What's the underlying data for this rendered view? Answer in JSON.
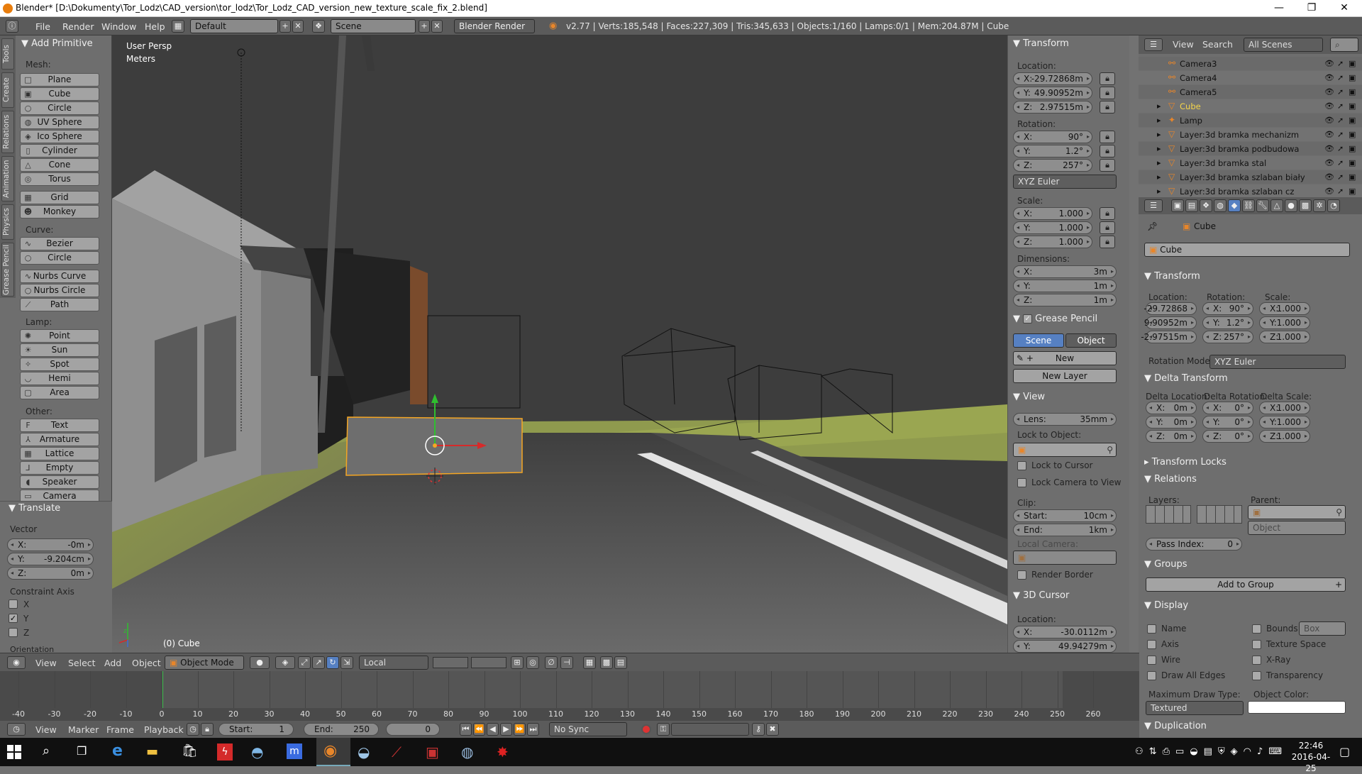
{
  "titlebar": {
    "title": "Blender* [D:\\Dokumenty\\Tor_Lodz\\CAD_version\\tor_lodz\\Tor_Lodz_CAD_version_new_texture_scale_fix_2.blend]",
    "minimize": "—",
    "maximize": "❐",
    "close": "✕"
  },
  "infobar": {
    "menus": [
      "File",
      "Render",
      "Window",
      "Help"
    ],
    "layout": "Default",
    "scene": "Scene",
    "engine": "Blender Render",
    "stats": "v2.77 | Verts:185,548 | Faces:227,309 | Tris:345,633 | Objects:1/160 | Lamps:0/1 | Mem:204.87M | Cube"
  },
  "tools": {
    "vtabs": [
      "Tools",
      "Create",
      "Relations",
      "Animation",
      "Physics",
      "Grease Pencil"
    ],
    "header": "Add Primitive",
    "mesh_label": "Mesh:",
    "mesh": [
      "Plane",
      "Cube",
      "Circle",
      "UV Sphere",
      "Ico Sphere",
      "Cylinder",
      "Cone",
      "Torus"
    ],
    "mesh2": [
      "Grid",
      "Monkey"
    ],
    "curve_label": "Curve:",
    "curve": [
      "Bezier",
      "Circle"
    ],
    "curve2": [
      "Nurbs Curve",
      "Nurbs Circle",
      "Path"
    ],
    "lamp_label": "Lamp:",
    "lamp": [
      "Point",
      "Sun",
      "Spot",
      "Hemi",
      "Area"
    ],
    "other_label": "Other:",
    "other": [
      "Text",
      "Armature",
      "Lattice",
      "Empty",
      "Speaker",
      "Camera"
    ]
  },
  "operator": {
    "header": "Translate",
    "vector_label": "Vector",
    "x_label": "X:",
    "x": "-0m",
    "y_label": "Y:",
    "y": "-9.204cm",
    "z_label": "Z:",
    "z": "0m",
    "constraint_label": "Constraint Axis",
    "cx": "X",
    "cy": "Y",
    "cz": "Z",
    "orientation": "Orientation"
  },
  "viewport": {
    "view_name": "User Persp",
    "units": "Meters",
    "object_label": "(0) Cube"
  },
  "npanel": {
    "transform_header": "Transform",
    "location_label": "Location:",
    "loc": [
      [
        "X:",
        "-29.72868m"
      ],
      [
        "Y:",
        "49.90952m"
      ],
      [
        "Z:",
        "2.97515m"
      ]
    ],
    "rotation_label": "Rotation:",
    "rot": [
      [
        "X:",
        "90°"
      ],
      [
        "Y:",
        "1.2°"
      ],
      [
        "Z:",
        "257°"
      ]
    ],
    "rot_mode": "XYZ Euler",
    "scale_label": "Scale:",
    "scale": [
      [
        "X:",
        "1.000"
      ],
      [
        "Y:",
        "1.000"
      ],
      [
        "Z:",
        "1.000"
      ]
    ],
    "dimensions_label": "Dimensions:",
    "dims": [
      [
        "X:",
        "3m"
      ],
      [
        "Y:",
        "1m"
      ],
      [
        "Z:",
        "1m"
      ]
    ],
    "grease_header": "Grease Pencil",
    "gp_scene": "Scene",
    "gp_object": "Object",
    "gp_new": "New",
    "gp_new_layer": "New Layer",
    "view_header": "View",
    "lens_label": "Lens:",
    "lens": "35mm",
    "lock_object": "Lock to Object:",
    "lock_cursor": "Lock to Cursor",
    "lock_camera": "Lock Camera to View",
    "clip_label": "Clip:",
    "clip_start_label": "Start:",
    "clip_start": "10cm",
    "clip_end_label": "End:",
    "clip_end": "1km",
    "local_camera": "Local Camera:",
    "render_border": "Render Border",
    "cursor_header": "3D Cursor",
    "cursor_loc_label": "Location:",
    "cursor": [
      [
        "X:",
        "-30.0112m"
      ],
      [
        "Y:",
        "49.94279m"
      ]
    ]
  },
  "outliner": {
    "view": "View",
    "search": "Search",
    "scenes": "All Scenes",
    "items": [
      "Camera3",
      "Camera4",
      "Camera5",
      "Cube",
      "Lamp",
      "Layer:3d bramka mechanizm",
      "Layer:3d bramka podbudowa",
      "Layer:3d bramka stal",
      "Layer:3d bramka szlaban biały",
      "Layer:3d bramka szlaban cz"
    ]
  },
  "properties": {
    "breadcrumb": "Cube",
    "name": "Cube",
    "transform_header": "Transform",
    "location_label": "Location:",
    "rotation_label": "Rotation:",
    "scale_label": "Scale:",
    "loc": [
      "-29.72868",
      "9.90952m",
      "-2.97515m"
    ],
    "rot": [
      [
        "X:",
        "90°"
      ],
      [
        "Y:",
        "1.2°"
      ],
      [
        "Z:",
        "257°"
      ]
    ],
    "scale": [
      [
        "X:",
        "1.000"
      ],
      [
        "Y:",
        "1.000"
      ],
      [
        "Z:",
        "1.000"
      ]
    ],
    "rotation_mode_label": "Rotation Mode:",
    "rotation_mode": "XYZ Euler",
    "delta_header": "Delta Transform",
    "delta_loc_label": "Delta Location:",
    "delta_rot_label": "Delta Rotation:",
    "delta_scale_label": "Delta Scale:",
    "delta_loc": [
      [
        "X:",
        "0m"
      ],
      [
        "Y:",
        "0m"
      ],
      [
        "Z:",
        "0m"
      ]
    ],
    "delta_rot": [
      [
        "X:",
        "0°"
      ],
      [
        "Y:",
        "0°"
      ],
      [
        "Z:",
        "0°"
      ]
    ],
    "delta_scale": [
      [
        "X:",
        "1.000"
      ],
      [
        "Y:",
        "1.000"
      ],
      [
        "Z:",
        "1.000"
      ]
    ],
    "locks_header": "Transform Locks",
    "relations_header": "Relations",
    "layers_label": "Layers:",
    "parent_label": "Parent:",
    "parent_type": "Object",
    "pass_index_label": "Pass Index:",
    "pass_index": "0",
    "groups_header": "Groups",
    "add_group": "Add to Group",
    "display_header": "Display",
    "d_name": "Name",
    "d_axis": "Axis",
    "d_wire": "Wire",
    "d_alledges": "Draw All Edges",
    "d_bounds": "Bounds",
    "d_bounds_type": "Box",
    "d_texspace": "Texture Space",
    "d_xray": "X-Ray",
    "d_transp": "Transparency",
    "max_draw_label": "Maximum Draw Type:",
    "max_draw": "Textured",
    "obj_color_label": "Object Color:",
    "duplication_header": "Duplication"
  },
  "vp3dheader": {
    "menus": [
      "View",
      "Select",
      "Add",
      "Object"
    ],
    "mode": "Object Mode",
    "orientation": "Local"
  },
  "timeline": {
    "ticks": [
      "-40",
      "-30",
      "-20",
      "-10",
      "0",
      "10",
      "20",
      "30",
      "40",
      "50",
      "60",
      "70",
      "80",
      "90",
      "100",
      "110",
      "120",
      "130",
      "140",
      "150",
      "160",
      "170",
      "180",
      "190",
      "200",
      "210",
      "220",
      "230",
      "240",
      "250",
      "260"
    ],
    "menus": [
      "View",
      "Marker",
      "Frame",
      "Playback"
    ],
    "start_label": "Start:",
    "start": "1",
    "end_label": "End:",
    "end": "250",
    "current": "0",
    "sync": "No Sync"
  },
  "taskbar": {
    "time": "22:46",
    "date": "2016-04-25"
  },
  "colors": {
    "accent": "#5680c2",
    "selected_orange": "#f5a623",
    "grass": "#9aa651"
  }
}
